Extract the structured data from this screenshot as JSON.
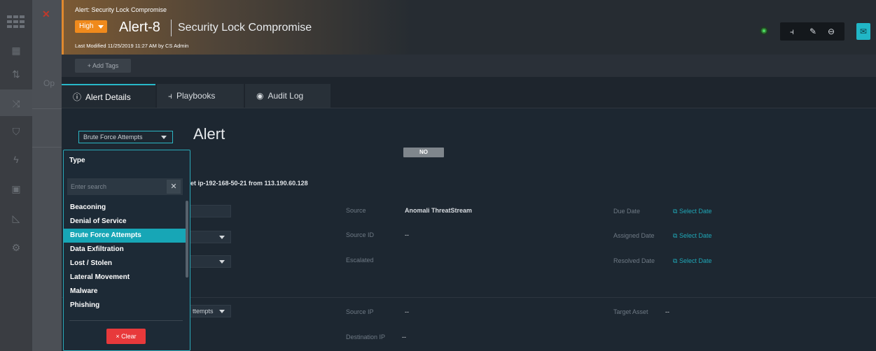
{
  "header": {
    "breadcrumb": "Alert: Security Lock Compromise",
    "severity": "High",
    "alert_id": "Alert-8",
    "alert_name": "Security Lock Compromise",
    "modified": "Last Modified 11/25/2019 11:27 AM by CS Admin",
    "status_color": "#4cd964",
    "accent_color": "#f08a1c"
  },
  "tags": {
    "add_label": "+ Add Tags"
  },
  "tabs": [
    {
      "label": "Alert Details",
      "icon": "info-icon"
    },
    {
      "label": "Playbooks",
      "icon": "playbook-icon"
    },
    {
      "label": "Audit Log",
      "icon": "eye-icon"
    }
  ],
  "leftnav": {
    "op_label": "Op"
  },
  "content": {
    "type_value": "Brute Force Attempts",
    "title": "Alert",
    "description": "et ip-192-168-50-21 from 113.190.60.128",
    "lower_type_value": "ttempts"
  },
  "fields": {
    "source_label": "Source",
    "source_value": "Anomali ThreatStream",
    "source_id_label": "Source ID",
    "source_id_value": "--",
    "escalated_label": "Escalated",
    "escalated_value": "NO",
    "due_date_label": "Due Date",
    "assigned_date_label": "Assigned Date",
    "resolved_date_label": "Resolved Date",
    "select_date": "Select Date",
    "source_ip_label": "Source IP",
    "source_ip_value": "--",
    "destination_ip_label": "Destination IP",
    "destination_ip_value": "--",
    "target_asset_label": "Target Asset",
    "target_asset_value": "--"
  },
  "dropdown": {
    "title": "Type",
    "search_placeholder": "Enter search",
    "clear_label": "× Clear",
    "options": [
      "Beaconing",
      "Denial of Service",
      "Brute Force Attempts",
      "Data Exfiltration",
      "Lost / Stolen",
      "Lateral Movement",
      "Malware",
      "Phishing"
    ],
    "selected": "Brute Force Attempts",
    "highlight_color": "#17a6b6",
    "clear_color": "#e8393b"
  }
}
